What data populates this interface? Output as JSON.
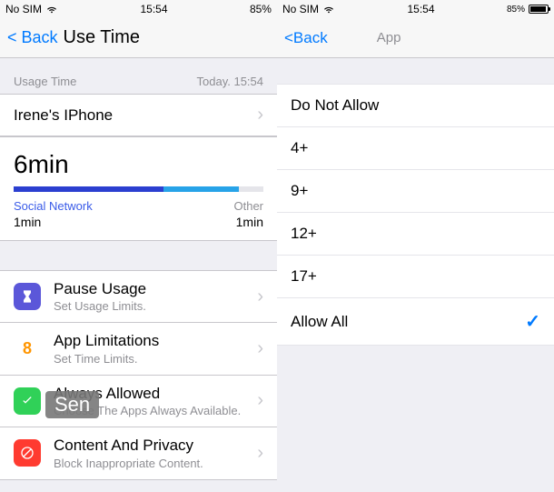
{
  "left": {
    "status": {
      "carrier": "No SIM",
      "time": "15:54",
      "battery": "85%"
    },
    "nav": {
      "back": "< Back",
      "title": "Use Time"
    },
    "section_header": {
      "label": "Usage Time",
      "right": "Today. 15:54"
    },
    "device_cell": {
      "title": "Irene's IPhone"
    },
    "usage": {
      "total": "6min",
      "cat1_label": "Social Network",
      "cat1_time": "1min",
      "cat2_label": "Other",
      "cat2_time": "1min"
    },
    "menu": [
      {
        "title": "Pause Usage",
        "sub": "Set Usage Limits."
      },
      {
        "title": "App Limitations",
        "sub": "Set Time Limits."
      },
      {
        "title": "Always Allowed",
        "sub": "Choose The Apps Always Available."
      },
      {
        "title": "Content And Privacy",
        "sub": "Block Inappropriate Content."
      }
    ]
  },
  "right": {
    "status": {
      "carrier": "No SIM",
      "time": "15:54",
      "battery": "85%"
    },
    "nav": {
      "back": "<Back",
      "title": "App"
    },
    "options": [
      "Do Not Allow",
      "4+",
      "9+",
      "12+",
      "17+",
      "Allow All"
    ],
    "selected_index": 5
  },
  "overlay": "Sen"
}
